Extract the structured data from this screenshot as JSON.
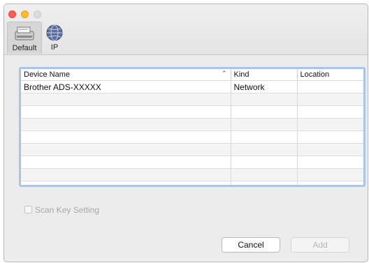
{
  "window": {
    "title": ""
  },
  "toolbar": {
    "items": [
      {
        "label": "Default",
        "icon": "scanner-icon",
        "selected": true
      },
      {
        "label": "IP",
        "icon": "globe-icon",
        "selected": false
      }
    ]
  },
  "table": {
    "columns": [
      "Device Name",
      "Kind",
      "Location"
    ],
    "sort_indicator": "^",
    "rows": [
      {
        "device_name": "Brother ADS-XXXXX",
        "kind": "Network",
        "location": ""
      }
    ]
  },
  "scan_key": {
    "label": "Scan Key Setting",
    "checked": false,
    "enabled": false
  },
  "buttons": {
    "cancel": "Cancel",
    "add": "Add"
  },
  "colors": {
    "selection_border": "#a9c4ea",
    "close": "#fc5f57",
    "minimize": "#fdbc2e"
  }
}
